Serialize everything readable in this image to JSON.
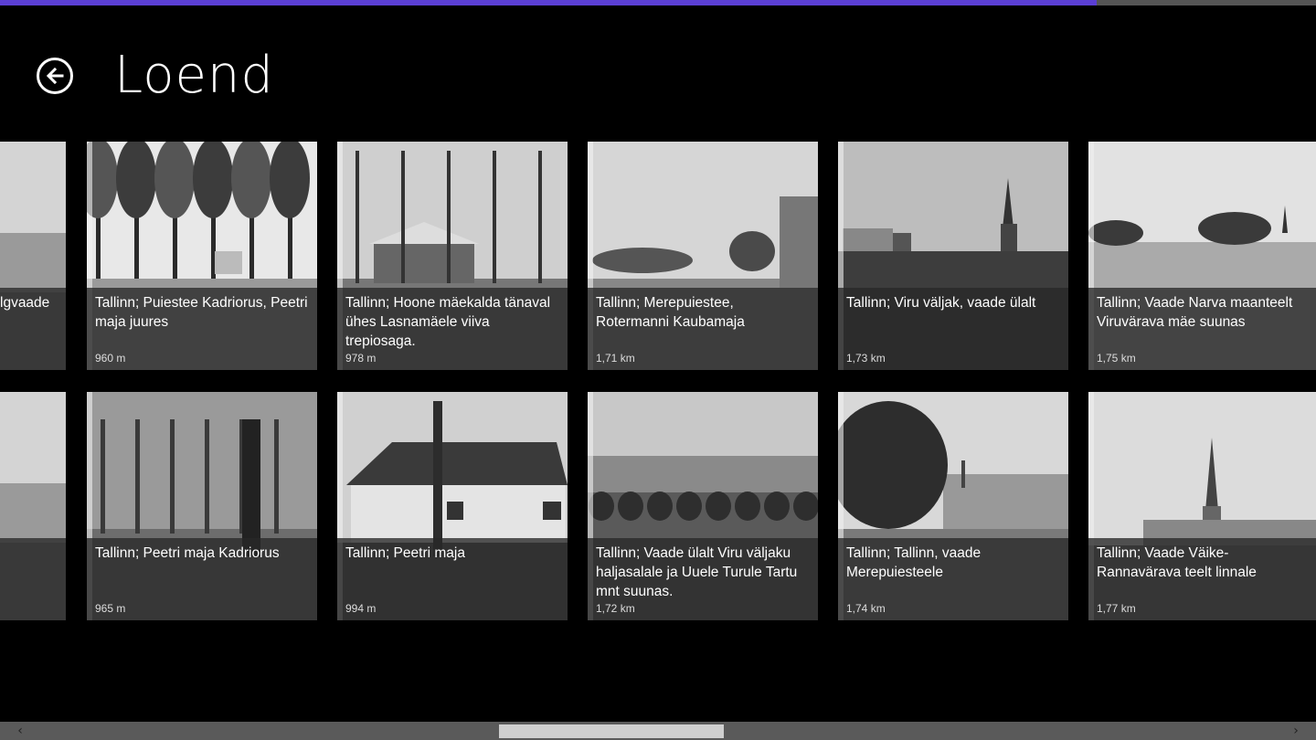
{
  "app": {
    "title": "Loend",
    "progress": 0.833,
    "accent_color": "#5b3fd4",
    "selection_color": "#4d7cd8"
  },
  "header": {
    "back_icon": "back-arrow-icon"
  },
  "tiles": [
    {
      "caption": "lgvaade",
      "distance": "",
      "selected": false,
      "scene": "building"
    },
    {
      "caption": "Tallinn; Puiestee Kadriorus, Peetri maja juures",
      "distance": "960 m",
      "selected": false,
      "scene": "snow-trees"
    },
    {
      "caption": "Tallinn; Hoone mäekalda tänaval ühes Lasnamäele viiva trepiosaga.",
      "distance": "978 m",
      "selected": false,
      "scene": "house-trees"
    },
    {
      "caption": "Tallinn; Merepuiestee, Rotermanni Kaubamaja",
      "distance": "1,71 km",
      "selected": true,
      "scene": "avenue"
    },
    {
      "caption": "Tallinn; Viru väljak, vaade ülalt",
      "distance": "1,73 km",
      "selected": false,
      "scene": "city-spire"
    },
    {
      "caption": "Tallinn; Vaade Narva maanteelt Viruvärava mäe suunas",
      "distance": "1,75 km",
      "selected": false,
      "scene": "street"
    },
    {
      "caption": "",
      "distance": "",
      "selected": false,
      "scene": "building"
    },
    {
      "caption": "Tallinn; Peetri maja Kadriorus",
      "distance": "965 m",
      "selected": false,
      "scene": "foggy-trees"
    },
    {
      "caption": "Tallinn; Peetri maja",
      "distance": "994 m",
      "selected": false,
      "scene": "cottage"
    },
    {
      "caption": "Tallinn; Vaade ülalt Viru väljaku haljasalale ja Uuele Turule Tartu mnt suunas.",
      "distance": "1,72 km",
      "selected": false,
      "scene": "park-city"
    },
    {
      "caption": "Tallinn; Tallinn, vaade Merepuiesteele",
      "distance": "1,74 km",
      "selected": true,
      "scene": "trees-buildings"
    },
    {
      "caption": "Tallinn; Vaade Väike-Rannavärava teelt linnale",
      "distance": "1,77 km",
      "selected": true,
      "scene": "church-spire"
    }
  ],
  "scrollbar": {
    "position": 0.455,
    "thumb_fraction": 0.178
  }
}
